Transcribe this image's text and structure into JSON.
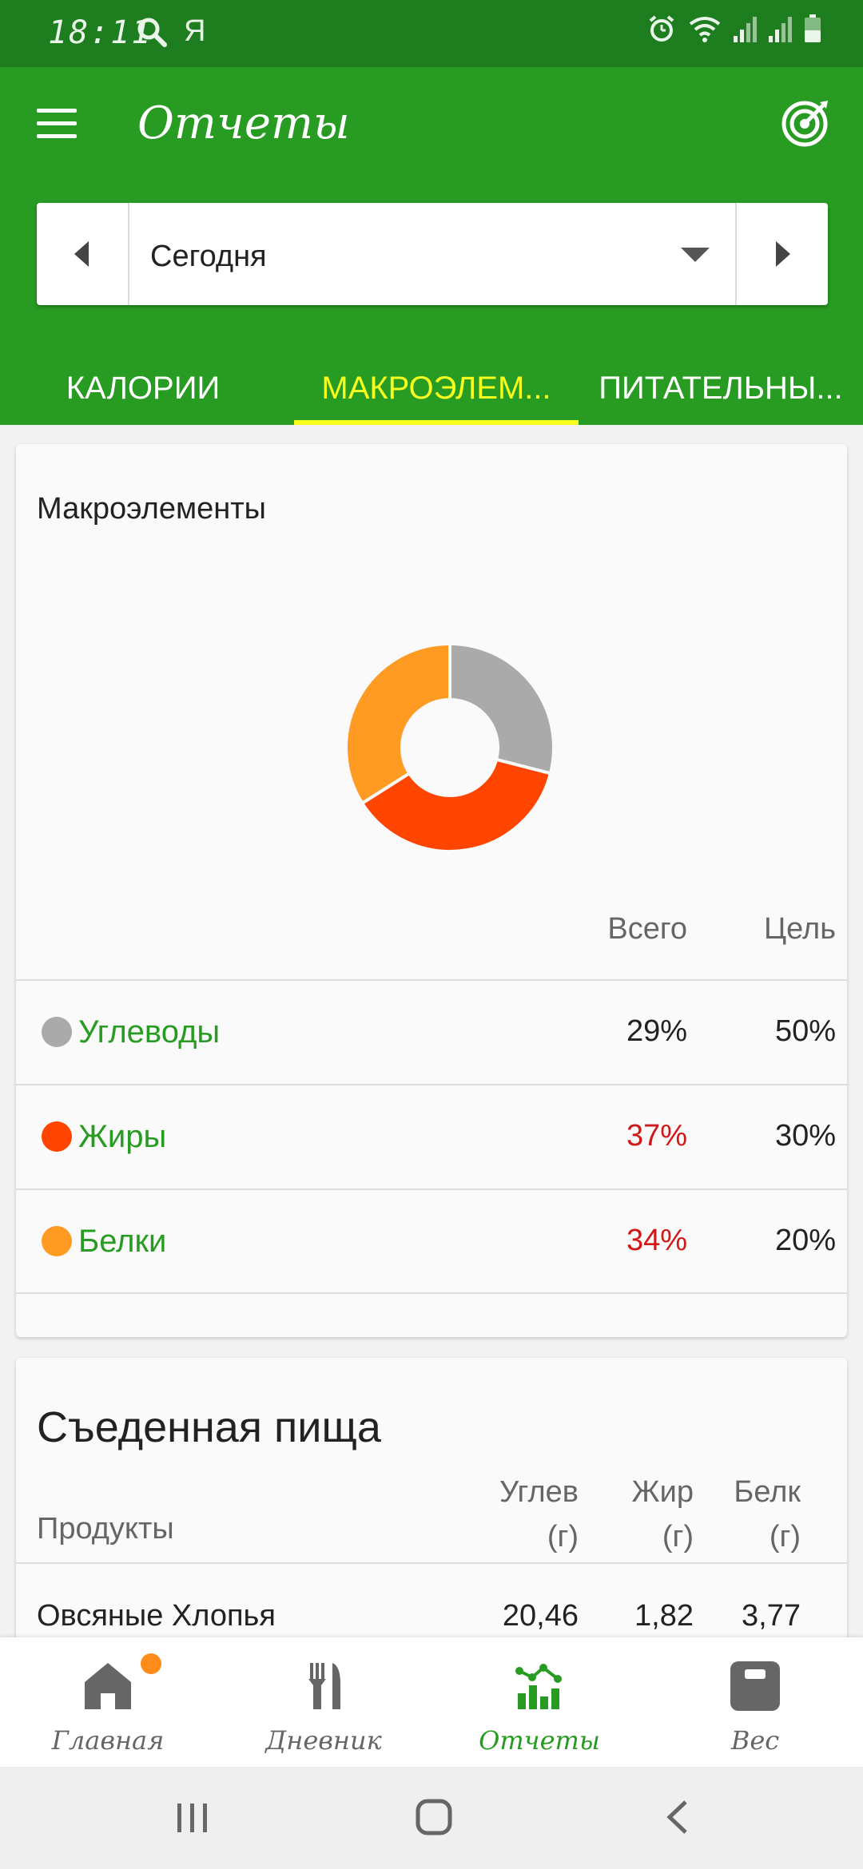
{
  "status_bar": {
    "time": "18:11",
    "carrier_glyph": "Я",
    "icons": [
      "search-icon",
      "alarm-icon",
      "wifi-icon",
      "signal-icon",
      "signal-icon",
      "battery-icon"
    ]
  },
  "app_bar": {
    "title": "Отчеты",
    "menu_icon": "menu-icon",
    "goal_icon": "target-icon"
  },
  "date_selector": {
    "value": "Сегодня"
  },
  "tabs": [
    {
      "label": "КАЛОРИИ",
      "active": false
    },
    {
      "label": "МАКРОЭЛЕМ...",
      "active": true
    },
    {
      "label": "ПИТАТЕЛЬНЫ...",
      "active": false
    }
  ],
  "macros_card": {
    "title": "Макроэлементы",
    "col_total": "Всего",
    "col_goal": "Цель",
    "rows": [
      {
        "name": "Углеводы",
        "total": "29%",
        "goal": "50%",
        "color": "#aaaaaa",
        "over": false
      },
      {
        "name": "Жиры",
        "total": "37%",
        "goal": "30%",
        "color": "#ff4500",
        "over": true
      },
      {
        "name": "Белки",
        "total": "34%",
        "goal": "20%",
        "color": "#ff9a22",
        "over": true
      }
    ]
  },
  "chart_data": {
    "type": "pie",
    "title": "Макроэлементы",
    "categories": [
      "Углеводы",
      "Жиры",
      "Белки"
    ],
    "values": [
      29,
      37,
      34
    ],
    "colors": [
      "#aaaaaa",
      "#ff4500",
      "#ff9a22"
    ]
  },
  "food_card": {
    "title": "Съеденная пища",
    "col_products": "Продукты",
    "col_carbs_1": "Углев",
    "col_carbs_2": "(г)",
    "col_fat_1": "Жир",
    "col_fat_2": "(г)",
    "col_protein_1": "Белк",
    "col_protein_2": "(г)",
    "rows": [
      {
        "name": "Овсяные Хлопья",
        "carbs": "20,46",
        "fat": "1,82",
        "protein": "3,77"
      }
    ]
  },
  "bottom_nav": [
    {
      "label": "Главная",
      "icon": "home-icon",
      "active": false,
      "badge": true
    },
    {
      "label": "Дневник",
      "icon": "fork-knife-icon",
      "active": false,
      "badge": false
    },
    {
      "label": "Отчеты",
      "icon": "chart-icon",
      "active": true,
      "badge": false
    },
    {
      "label": "Вес",
      "icon": "scale-icon",
      "active": false,
      "badge": false
    }
  ],
  "colors": {
    "primary": "#289b22",
    "primary_dark": "#1e7d1e",
    "tab_active": "#f7ff1e",
    "over_goal": "#d01818"
  }
}
